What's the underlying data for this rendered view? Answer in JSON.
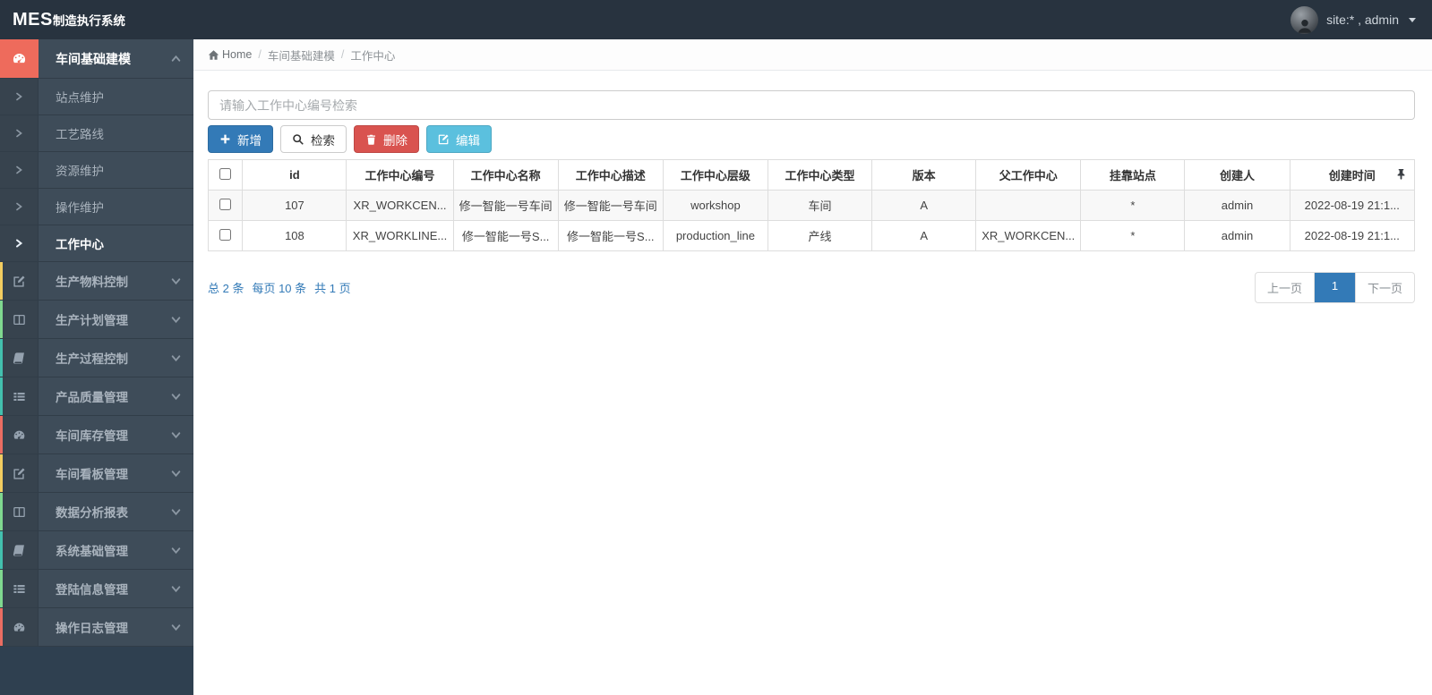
{
  "topbar": {
    "logo_bold": "MES",
    "logo_text": "制造执行系统",
    "user_label": "site:* , admin"
  },
  "sidebar": {
    "group": {
      "label": "车间基础建模",
      "icon_bg": "#ee6b5c"
    },
    "children": [
      {
        "label": "站点维护"
      },
      {
        "label": "工艺路线"
      },
      {
        "label": "资源维护"
      },
      {
        "label": "操作维护"
      },
      {
        "label": "工作中心",
        "active": true
      }
    ],
    "items": [
      {
        "label": "生产物料控制",
        "strip_color": "#f3cd60"
      },
      {
        "label": "生产计划管理",
        "strip_color": "#7fd88f"
      },
      {
        "label": "生产过程控制",
        "strip_color": "#43c0ae"
      },
      {
        "label": "产品质量管理",
        "strip_color": "#43c0ae"
      },
      {
        "label": "车间库存管理",
        "strip_color": "#eb6d62"
      },
      {
        "label": "车间看板管理",
        "strip_color": "#f3cd60"
      },
      {
        "label": "数据分析报表",
        "strip_color": "#7fd88f"
      },
      {
        "label": "系统基础管理",
        "strip_color": "#43c0ae"
      },
      {
        "label": "登陆信息管理",
        "strip_color": "#7fd88f"
      },
      {
        "label": "操作日志管理",
        "strip_color": "#eb6d62"
      }
    ]
  },
  "breadcrumb": {
    "home": "Home",
    "separator": "/",
    "level1": "车间基础建模",
    "level2": "工作中心"
  },
  "toolbar": {
    "search_placeholder": "请输入工作中心编号检索",
    "buttons": {
      "add": {
        "label": "新增",
        "bg": "#337ab7"
      },
      "search": {
        "label": "检索",
        "bg": "#ffffff"
      },
      "delete": {
        "label": "删除",
        "bg": "#d9534f"
      },
      "edit": {
        "label": "编辑",
        "bg": "#5bc0de"
      }
    }
  },
  "table": {
    "columns": [
      "id",
      "工作中心编号",
      "工作中心名称",
      "工作中心描述",
      "工作中心层级",
      "工作中心类型",
      "版本",
      "父工作中心",
      "挂靠站点",
      "创建人",
      "创建时间"
    ],
    "rows": [
      {
        "cells": [
          "107",
          "XR_WORKCEN...",
          "修一智能一号车间",
          "修一智能一号车间",
          "workshop",
          "车间",
          "A",
          "",
          "*",
          "admin",
          "2022-08-19 21:1..."
        ]
      },
      {
        "cells": [
          "108",
          "XR_WORKLINE...",
          "修一智能一号S...",
          "修一智能一号S...",
          "production_line",
          "产线",
          "A",
          "XR_WORKCEN...",
          "*",
          "admin",
          "2022-08-19 21:1..."
        ]
      }
    ]
  },
  "pagination": {
    "summary_total": "总 2 条",
    "summary_per_page": "每页 10 条",
    "summary_pages": "共 1 页",
    "info_color": "#337ab7",
    "prev": "上一页",
    "current": "1",
    "next": "下一页",
    "active_color": "#337ab7"
  }
}
